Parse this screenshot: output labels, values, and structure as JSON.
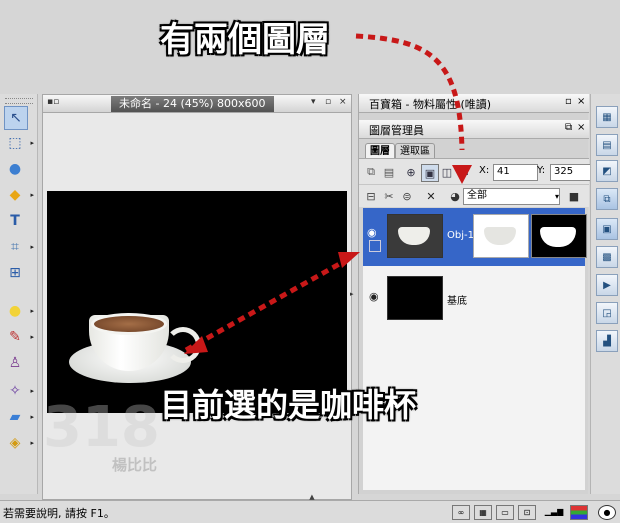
{
  "annotations": {
    "top_callout": "有兩個圖層",
    "bottom_callout": "目前選的是咖啡杯",
    "accent_color": "#c81818"
  },
  "toolbar": {
    "tools": [
      {
        "name": "pointer-tool-icon",
        "glyph": "↖"
      },
      {
        "name": "marquee-tool-icon",
        "glyph": "⬚"
      },
      {
        "name": "object-tool-icon",
        "glyph": "●"
      },
      {
        "name": "shape-tool-icon",
        "glyph": "◆"
      },
      {
        "name": "text-tool-icon",
        "glyph": "T"
      },
      {
        "name": "crop-tool-icon",
        "glyph": "⌗"
      },
      {
        "name": "transform-tool-icon",
        "glyph": "⊞"
      },
      {
        "name": "light-tool-icon",
        "glyph": "●"
      },
      {
        "name": "brush-tool-icon",
        "glyph": "✎"
      },
      {
        "name": "clone-tool-icon",
        "glyph": "♙"
      },
      {
        "name": "retouch-tool-icon",
        "glyph": "✧"
      },
      {
        "name": "eraser-tool-icon",
        "glyph": "▰"
      },
      {
        "name": "fill-tool-icon",
        "glyph": "◈"
      }
    ]
  },
  "document": {
    "title": "未命名 - 24 (45%) 800x600"
  },
  "panels": {
    "top_panel_title": "百寶箱 - 物料屬性 (唯讀)",
    "layer_manager_title": "圖層管理員",
    "tabs": [
      "圖層",
      "選取區"
    ],
    "x_label": "X:",
    "x_value": "41",
    "y_label": "Y:",
    "y_value": "325",
    "mode_value": "全部",
    "layers": [
      {
        "name": "Obj-1",
        "selected": true
      },
      {
        "name": "基底",
        "selected": false
      }
    ]
  },
  "status": {
    "message": "若需要說明, 請按 F1。"
  },
  "watermark": {
    "large": "318",
    "small": "楊比比"
  }
}
